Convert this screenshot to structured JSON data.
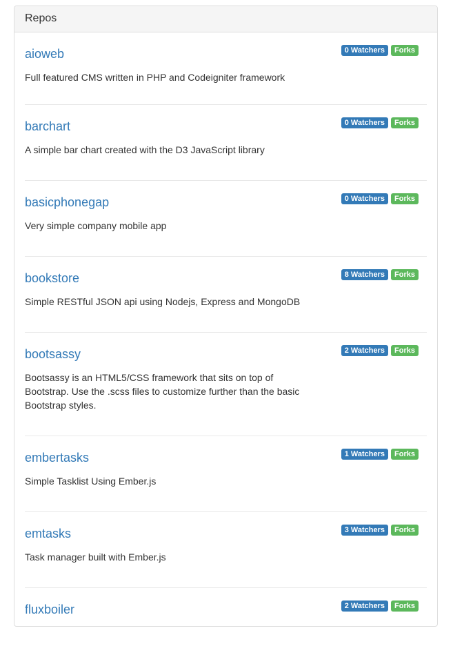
{
  "panel": {
    "title": "Repos"
  },
  "repos": [
    {
      "name": "aioweb",
      "description": "Full featured CMS written in PHP and Codeigniter framework",
      "watchers_label": "0 Watchers",
      "forks_label": "Forks"
    },
    {
      "name": "barchart",
      "description": "A simple bar chart created with the D3 JavaScript library",
      "watchers_label": "0 Watchers",
      "forks_label": "Forks"
    },
    {
      "name": "basicphonegap",
      "description": "Very simple company mobile app",
      "watchers_label": "0 Watchers",
      "forks_label": "Forks"
    },
    {
      "name": "bookstore",
      "description": "Simple RESTful JSON api using Nodejs, Express and MongoDB",
      "watchers_label": "8 Watchers",
      "forks_label": "Forks"
    },
    {
      "name": "bootsassy",
      "description": "Bootsassy is an HTML5/CSS framework that sits on top of Bootstrap. Use the .scss files to customize further than the basic Bootstrap styles.",
      "watchers_label": "2 Watchers",
      "forks_label": "Forks"
    },
    {
      "name": "embertasks",
      "description": "Simple Tasklist Using Ember.js",
      "watchers_label": "1 Watchers",
      "forks_label": "Forks"
    },
    {
      "name": "emtasks",
      "description": "Task manager built with Ember.js",
      "watchers_label": "3 Watchers",
      "forks_label": "Forks"
    },
    {
      "name": "fluxboiler",
      "description": "",
      "watchers_label": "2 Watchers",
      "forks_label": "Forks"
    }
  ],
  "colors": {
    "link": "#337ab7",
    "watchers_badge": "#337ab7",
    "forks_badge": "#5cb85c"
  }
}
